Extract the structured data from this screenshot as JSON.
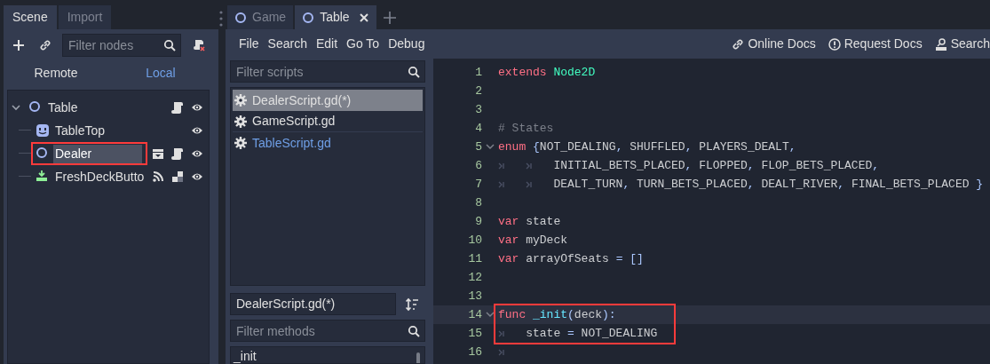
{
  "dock_tabs": [
    {
      "label": "Scene",
      "selected": true
    },
    {
      "label": "Import",
      "selected": false
    }
  ],
  "scene_toolbar": {
    "placeholder": "Filter nodes"
  },
  "scene_modes": [
    {
      "label": "Remote",
      "selected": false
    },
    {
      "label": "Local",
      "selected": true
    }
  ],
  "scene_tree": [
    {
      "name": "Table",
      "kind": "node2d",
      "selected": false,
      "highlighted": false,
      "expanded": true,
      "badges": [
        {
          "kind": "script"
        },
        {
          "kind": "visible"
        }
      ],
      "children": [
        {
          "name": "TableTop",
          "kind": "sprite",
          "selected": false,
          "highlighted": false,
          "badges": [
            {
              "kind": "visible"
            }
          ]
        },
        {
          "name": "Dealer",
          "kind": "node2d",
          "selected": true,
          "highlighted": true,
          "badges": [
            {
              "kind": "instance"
            },
            {
              "kind": "script"
            },
            {
              "kind": "visible"
            }
          ]
        },
        {
          "name": "FreshDeckButto",
          "kind": "button",
          "selected": false,
          "highlighted": false,
          "badges": [
            {
              "kind": "signal"
            },
            {
              "kind": "group"
            },
            {
              "kind": "visible"
            }
          ]
        }
      ]
    }
  ],
  "editor_tabs": [
    {
      "label": "Game",
      "selected": false
    },
    {
      "label": "Table",
      "selected": true
    }
  ],
  "menu": [
    "File",
    "Search",
    "Edit",
    "Go To",
    "Debug"
  ],
  "doc_links": [
    {
      "label": "Online Docs",
      "kind": "link"
    },
    {
      "label": "Request Docs",
      "kind": "request"
    },
    {
      "label": "Search",
      "kind": "search"
    }
  ],
  "scripts_filter": {
    "placeholder": "Filter scripts"
  },
  "scripts": [
    {
      "name": "DealerScript.gd(*)",
      "selected": true,
      "kind": "plain"
    },
    {
      "name": "GameScript.gd",
      "selected": false,
      "kind": "plain"
    },
    {
      "name": "TableScript.gd",
      "selected": false,
      "kind": "accent"
    }
  ],
  "current_script": "DealerScript.gd(*)",
  "methods_filter": {
    "placeholder": "Filter methods"
  },
  "methods": [
    "_init"
  ],
  "code": [
    {
      "number": "1",
      "fold": false,
      "current": false,
      "annotated": false,
      "tokens": [
        {
          "kind": "keyword",
          "text": "extends"
        },
        {
          "kind": "type",
          "text": " Node2D"
        }
      ]
    },
    {
      "number": "2",
      "fold": false,
      "current": false,
      "annotated": false
    },
    {
      "number": "3",
      "fold": false,
      "current": false,
      "annotated": false
    },
    {
      "number": "4",
      "fold": false,
      "current": false,
      "annotated": false,
      "tokens": [
        {
          "kind": "comment",
          "text": "# States"
        }
      ]
    },
    {
      "number": "5",
      "fold": true,
      "current": false,
      "annotated": false,
      "tokens": [
        {
          "kind": "keyword",
          "text": "enum"
        },
        {
          "kind": "symbol",
          "text": " {"
        },
        {
          "kind": "text",
          "text": "NOT_DEALING"
        },
        {
          "kind": "symbol",
          "text": ", "
        },
        {
          "kind": "text",
          "text": "SHUFFLED"
        },
        {
          "kind": "symbol",
          "text": ", "
        },
        {
          "kind": "text",
          "text": "PLAYERS_DEALT"
        },
        {
          "kind": "symbol",
          "text": ","
        }
      ]
    },
    {
      "number": "6",
      "fold": false,
      "current": false,
      "annotated": false,
      "tokens": [
        {
          "kind": "tab"
        },
        {
          "kind": "tab"
        },
        {
          "kind": "text",
          "text": "INITIAL_BETS_PLACED"
        },
        {
          "kind": "symbol",
          "text": ", "
        },
        {
          "kind": "text",
          "text": "FLOPPED"
        },
        {
          "kind": "symbol",
          "text": ", "
        },
        {
          "kind": "text",
          "text": "FLOP_BETS_PLACED"
        },
        {
          "kind": "symbol",
          "text": ","
        }
      ]
    },
    {
      "number": "7",
      "fold": false,
      "current": false,
      "annotated": false,
      "tokens": [
        {
          "kind": "tab"
        },
        {
          "kind": "tab"
        },
        {
          "kind": "text",
          "text": "DEALT_TURN"
        },
        {
          "kind": "symbol",
          "text": ", "
        },
        {
          "kind": "text",
          "text": "TURN_BETS_PLACED"
        },
        {
          "kind": "symbol",
          "text": ", "
        },
        {
          "kind": "text",
          "text": "DEALT_RIVER"
        },
        {
          "kind": "symbol",
          "text": ", "
        },
        {
          "kind": "text",
          "text": "FINAL_BETS_PLACED "
        },
        {
          "kind": "symbol",
          "text": "}"
        }
      ]
    },
    {
      "number": "8",
      "fold": false,
      "current": false,
      "annotated": false
    },
    {
      "number": "9",
      "fold": false,
      "current": false,
      "annotated": false,
      "tokens": [
        {
          "kind": "keyword",
          "text": "var"
        },
        {
          "kind": "text",
          "text": " state"
        }
      ]
    },
    {
      "number": "10",
      "fold": false,
      "current": false,
      "annotated": false,
      "tokens": [
        {
          "kind": "keyword",
          "text": "var"
        },
        {
          "kind": "text",
          "text": " myDeck"
        }
      ]
    },
    {
      "number": "11",
      "fold": false,
      "current": false,
      "annotated": false,
      "tokens": [
        {
          "kind": "keyword",
          "text": "var"
        },
        {
          "kind": "text",
          "text": " arrayOfSeats "
        },
        {
          "kind": "symbol",
          "text": "= []"
        }
      ]
    },
    {
      "number": "12",
      "fold": false,
      "current": false,
      "annotated": false
    },
    {
      "number": "13",
      "fold": false,
      "current": false,
      "annotated": false
    },
    {
      "number": "14",
      "fold": true,
      "current": true,
      "annotated": true,
      "tokens": [
        {
          "kind": "keyword",
          "text": "func"
        },
        {
          "kind": "function",
          "text": " _init"
        },
        {
          "kind": "symbol",
          "text": "("
        },
        {
          "kind": "text",
          "text": "deck"
        },
        {
          "kind": "symbol",
          "text": "):"
        }
      ]
    },
    {
      "number": "15",
      "fold": false,
      "current": false,
      "annotated": true,
      "tokens": [
        {
          "kind": "tab"
        },
        {
          "kind": "text",
          "text": "state "
        },
        {
          "kind": "symbol",
          "text": "= "
        },
        {
          "kind": "text",
          "text": "NOT_DEALING"
        }
      ]
    },
    {
      "number": "16",
      "fold": false,
      "current": false,
      "annotated": false,
      "tokens": [
        {
          "kind": "tab"
        }
      ]
    }
  ]
}
